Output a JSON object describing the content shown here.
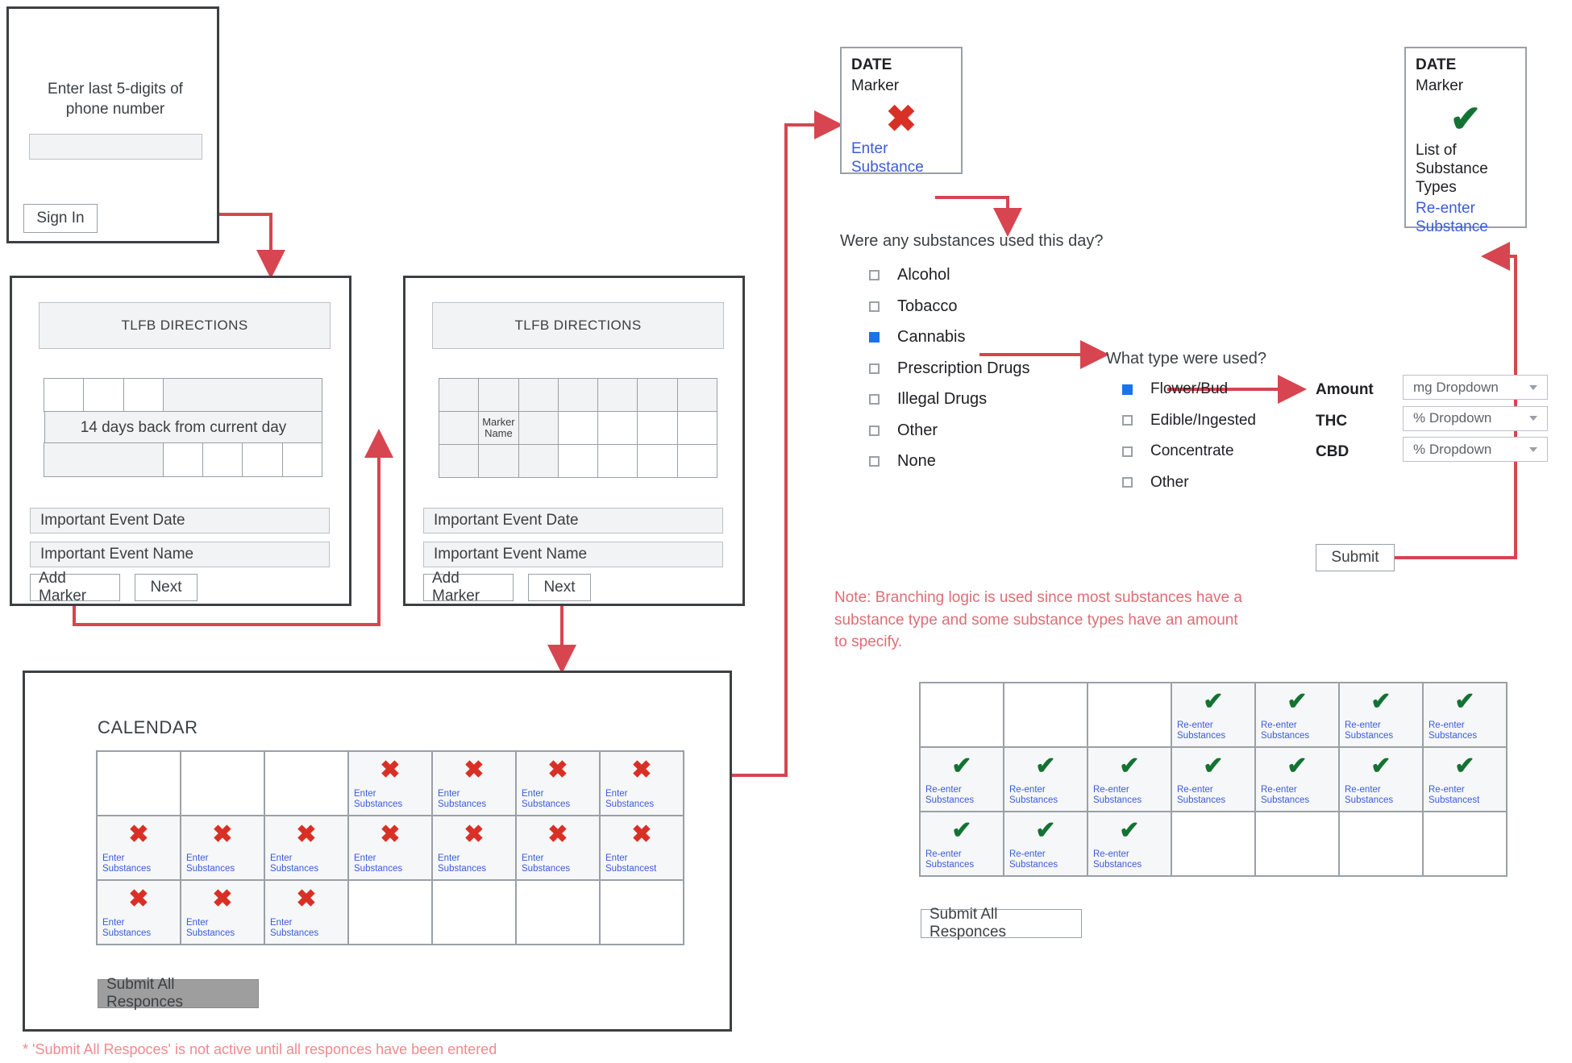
{
  "signin": {
    "prompt_line1": "Enter last 5-digits of",
    "prompt_line2": "phone number",
    "input_value": "",
    "button_label": "Sign In"
  },
  "tlfb1": {
    "header": "TLFB DIRECTIONS",
    "grid_caption": "14 days back from current day",
    "event_date_placeholder": "Important Event Date",
    "event_name_placeholder": "Important Event Name",
    "add_marker_label": "Add Marker",
    "next_label": "Next"
  },
  "tlfb2": {
    "header": "TLFB DIRECTIONS",
    "marker_cell_line1": "Marker",
    "marker_cell_line2": "Name",
    "event_date_placeholder": "Important Event Date",
    "event_name_placeholder": "Important Event Name",
    "add_marker_label": "Add Marker",
    "next_label": "Next"
  },
  "calendar": {
    "title": "CALENDAR",
    "submit_label": "Submit All Responces",
    "submit_disabled": true,
    "cell_link_line1": "Enter",
    "cell_link_line2": "Substances",
    "cell_link_line2_alt": "Substancest",
    "mark": "✖",
    "rows": [
      [
        {
          "filled": false
        },
        {
          "filled": false
        },
        {
          "filled": false
        },
        {
          "filled": true,
          "link": "Enter Substances"
        },
        {
          "filled": true,
          "link": "Enter Substances"
        },
        {
          "filled": true,
          "link": "Enter Substances"
        },
        {
          "filled": true,
          "link": "Enter Substances"
        }
      ],
      [
        {
          "filled": true,
          "link": "Enter Substances"
        },
        {
          "filled": true,
          "link": "Enter Substances"
        },
        {
          "filled": true,
          "link": "Enter Substances"
        },
        {
          "filled": true,
          "link": "Enter Substances"
        },
        {
          "filled": true,
          "link": "Enter Substances"
        },
        {
          "filled": true,
          "link": "Enter Substances"
        },
        {
          "filled": true,
          "link": "Enter Substancest"
        }
      ],
      [
        {
          "filled": true,
          "link": "Enter Substances"
        },
        {
          "filled": true,
          "link": "Enter Substances"
        },
        {
          "filled": true,
          "link": "Enter Substances"
        },
        {
          "filled": false
        },
        {
          "filled": false
        },
        {
          "filled": false
        },
        {
          "filled": false
        }
      ]
    ],
    "footnote": "* 'Submit All Respoces' is not active until all responces have been entered"
  },
  "calendar_done": {
    "submit_label": "Submit All Responces",
    "mark": "✔",
    "rows": [
      [
        {
          "filled": false
        },
        {
          "filled": false
        },
        {
          "filled": false
        },
        {
          "filled": true,
          "link": "Re-enter Substances"
        },
        {
          "filled": true,
          "link": "Re-enter Substances"
        },
        {
          "filled": true,
          "link": "Re-enter Substances"
        },
        {
          "filled": true,
          "link": "Re-enter Substances"
        }
      ],
      [
        {
          "filled": true,
          "link": "Re-enter Substances"
        },
        {
          "filled": true,
          "link": "Re-enter Substances"
        },
        {
          "filled": true,
          "link": "Re-enter Substances"
        },
        {
          "filled": true,
          "link": "Re-enter Substances"
        },
        {
          "filled": true,
          "link": "Re-enter Substances"
        },
        {
          "filled": true,
          "link": "Re-enter Substances"
        },
        {
          "filled": true,
          "link": "Re-enter Substancest"
        }
      ],
      [
        {
          "filled": true,
          "link": "Re-enter Substances"
        },
        {
          "filled": true,
          "link": "Re-enter Substances"
        },
        {
          "filled": true,
          "link": "Re-enter Substances"
        },
        {
          "filled": false
        },
        {
          "filled": false
        },
        {
          "filled": false
        },
        {
          "filled": false
        }
      ]
    ]
  },
  "marker_card_pending": {
    "date": "DATE",
    "marker": "Marker",
    "mark": "✖",
    "link_line1": "Enter",
    "link_line2": "Substance"
  },
  "marker_card_done": {
    "date": "DATE",
    "marker": "Marker",
    "mark": "✔",
    "list_line1": "List of",
    "list_line2": "Substance",
    "list_line3": "Types",
    "link_line1": "Re-enter",
    "link_line2": "Substance"
  },
  "substances": {
    "question": "Were any substances used this day?",
    "options": [
      {
        "label": "Alcohol",
        "checked": false
      },
      {
        "label": "Tobacco",
        "checked": false
      },
      {
        "label": "Cannabis",
        "checked": true
      },
      {
        "label": "Prescription Drugs",
        "checked": false
      },
      {
        "label": "Illegal Drugs",
        "checked": false
      },
      {
        "label": "Other",
        "checked": false
      },
      {
        "label": "None",
        "checked": false
      }
    ]
  },
  "types": {
    "question": "What type were used?",
    "options": [
      {
        "label": "Flower/Bud",
        "checked": true
      },
      {
        "label": "Edible/Ingested",
        "checked": false
      },
      {
        "label": "Concentrate",
        "checked": false
      },
      {
        "label": "Other",
        "checked": false
      }
    ]
  },
  "amounts": {
    "rows": [
      {
        "label": "Amount",
        "value": "mg Dropdown"
      },
      {
        "label": "THC",
        "value": "% Dropdown"
      },
      {
        "label": "CBD",
        "value": "% Dropdown"
      }
    ],
    "submit_label": "Submit"
  },
  "branching_note": {
    "line1": "Note: Branching logic is used since most substances have a",
    "line2": "substance type and some substance types have an amount",
    "line3": "to specify."
  },
  "colors": {
    "arrow": "#d64550",
    "x_mark": "#d93025",
    "check_mark": "#137333",
    "link": "#3b5bdb",
    "checkbox_checked": "#1a73e8",
    "note": "#e06c75",
    "panel_border": "#3c4043"
  }
}
